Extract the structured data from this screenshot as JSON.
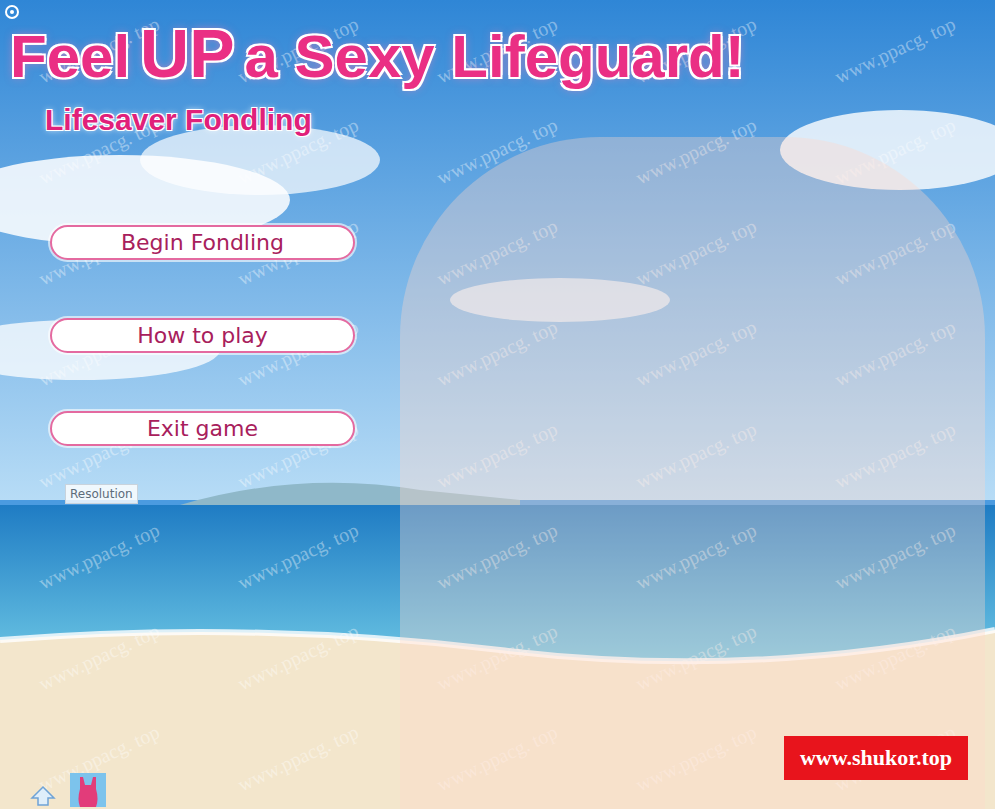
{
  "title": {
    "segments": [
      {
        "text": "Feel",
        "kind": "normal"
      },
      {
        "text": "UP",
        "kind": "big"
      },
      {
        "text": "a Sexy Lifeguard!",
        "kind": "normal"
      }
    ],
    "subtitle": "Lifesaver Fondling"
  },
  "menu": [
    {
      "label": "Begin Fondling"
    },
    {
      "label": "How to play"
    },
    {
      "label": "Exit game"
    }
  ],
  "resolution_button": "Resolution",
  "watermark": "www.ppacg. top",
  "banner": "www.shukor.top"
}
